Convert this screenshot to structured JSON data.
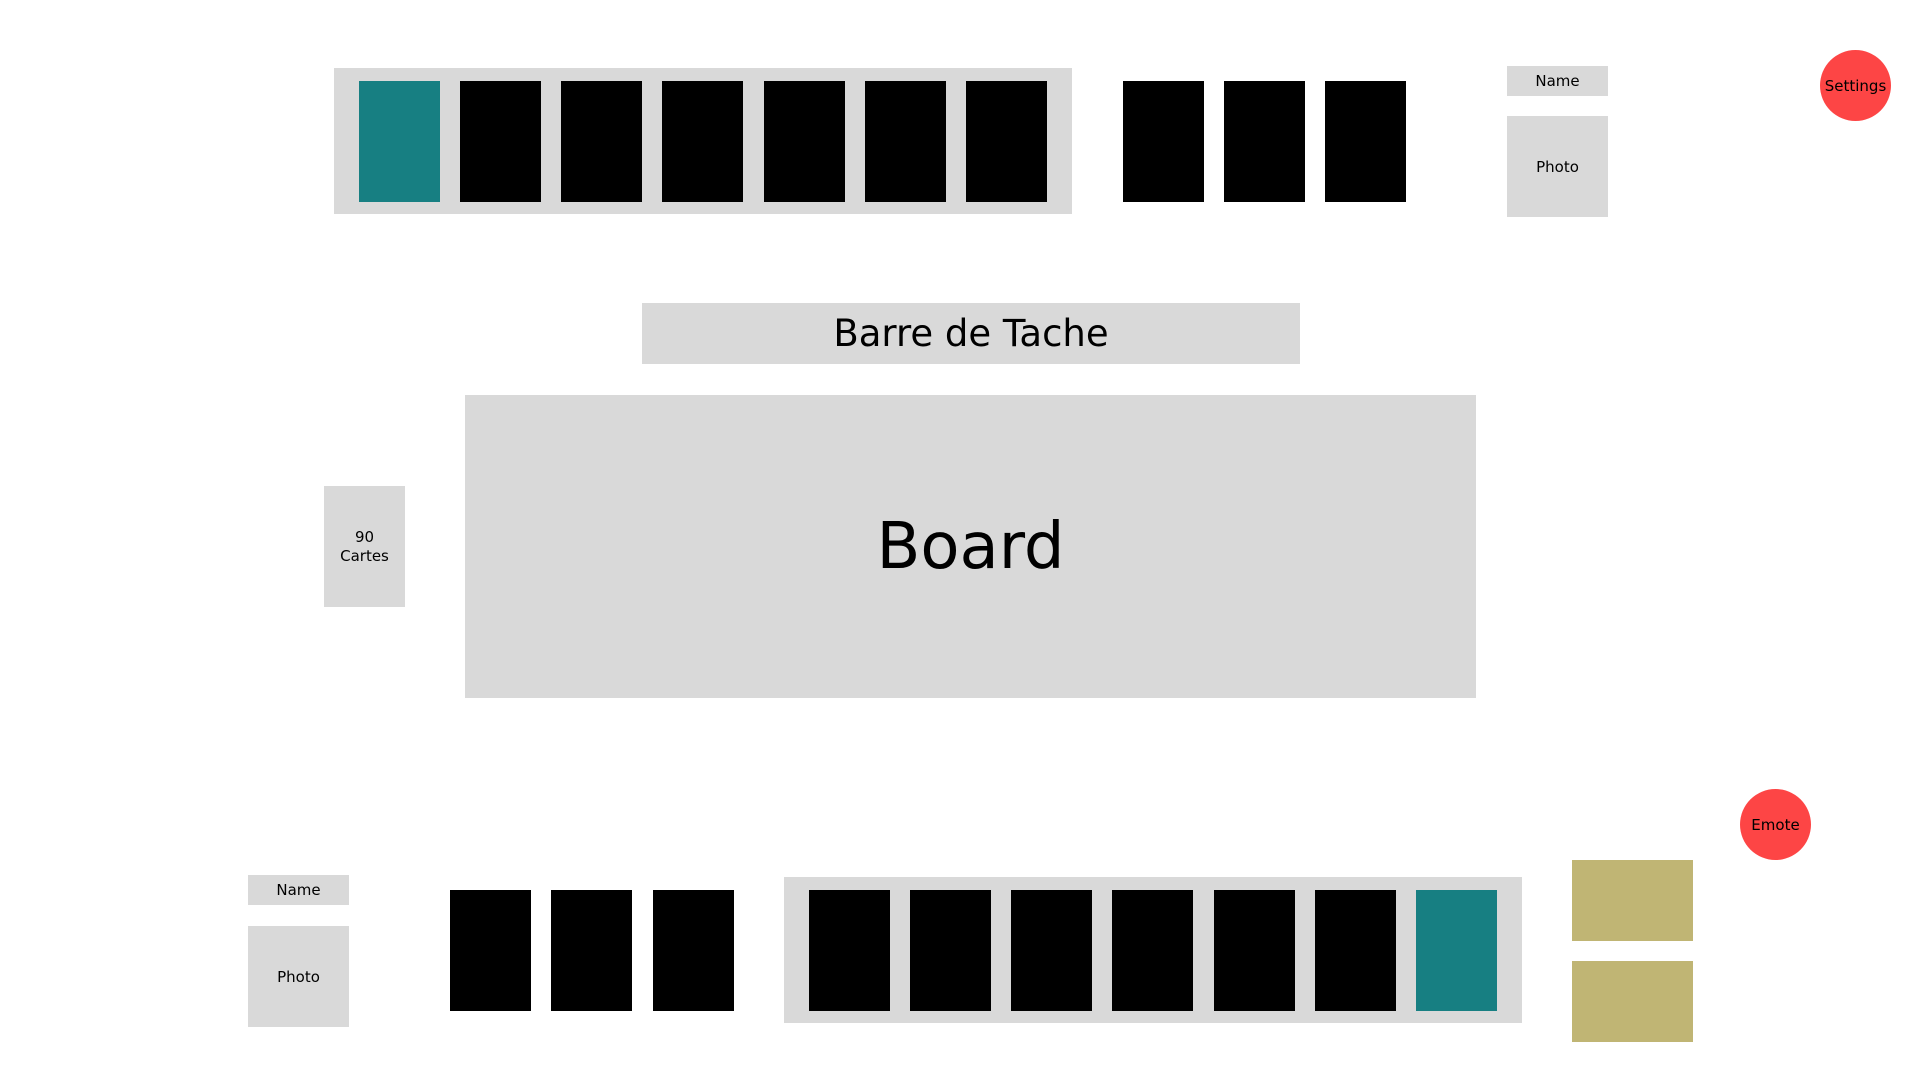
{
  "colors": {
    "panel": "#d9d9d9",
    "card_back": "#000000",
    "card_highlight": "#177f82",
    "button": "#fd4545",
    "emote_slot": "#c0b574"
  },
  "opponent": {
    "name_label": "Name",
    "photo_label": "Photo",
    "hand_cards": 7,
    "highlighted_card_index": 0,
    "side_cards": 3
  },
  "player": {
    "name_label": "Name",
    "photo_label": "Photo",
    "hand_cards": 7,
    "highlighted_card_index": 6,
    "side_cards": 3
  },
  "taskbar": {
    "label": "Barre de Tache"
  },
  "board": {
    "label": "Board"
  },
  "deck": {
    "count": "90",
    "unit": "Cartes"
  },
  "buttons": {
    "settings": "Settings",
    "emote": "Emote"
  },
  "emote_slots": 2
}
